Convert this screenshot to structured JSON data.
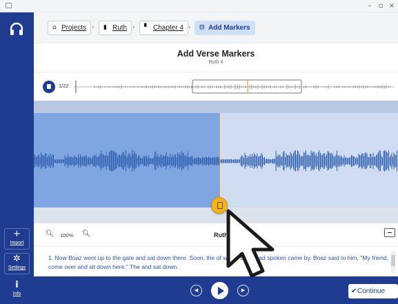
{
  "window": {
    "controls": {
      "minimize": "–",
      "maximize": "▫",
      "close": "×"
    }
  },
  "sidebar": {
    "logo_icon": "headphones-icon",
    "items": [
      {
        "label": "Import",
        "icon": "plus-icon",
        "glyph": "+"
      },
      {
        "label": "Settings",
        "icon": "gear-icon",
        "glyph": "✲"
      },
      {
        "label": "Info",
        "icon": "info-icon",
        "glyph": "i"
      }
    ]
  },
  "breadcrumb": {
    "items": [
      {
        "label": "Projects",
        "icon": "home-icon",
        "glyph": "⌂"
      },
      {
        "label": "Ruth",
        "icon": "book-icon",
        "glyph": "▮"
      },
      {
        "label": "Chapter 4",
        "icon": "document-icon",
        "glyph": "▘"
      },
      {
        "label": "Add Markers",
        "icon": "bookmark-icon",
        "glyph": "⊟"
      }
    ],
    "separator": "›"
  },
  "header": {
    "title": "Add Verse Markers",
    "subtitle": "Ruth 4"
  },
  "overview": {
    "marker_count": "1/22"
  },
  "playback": {
    "progress_fraction": 0.51
  },
  "zoom": {
    "value": "100%",
    "zoom_out_icon": "zoom-out-icon",
    "zoom_in_icon": "zoom-in-icon",
    "title": "Ruth"
  },
  "text": {
    "content": "1. Now Boaz went up to the gate and sat down there. Soon, the                 of whom Boaz had spoken came by. Boaz said to him, \"My friend, come over and sit down here.\" The                   and sat down."
  },
  "player": {
    "prev_icon": "skip-back-icon",
    "play_icon": "play-icon",
    "next_icon": "skip-forward-icon",
    "continue_label": "Continue"
  },
  "colors": {
    "brand": "#1f3c91",
    "played": "#7fa6e0",
    "unplayed": "#cfdcf2",
    "marker": "#f2b418"
  }
}
